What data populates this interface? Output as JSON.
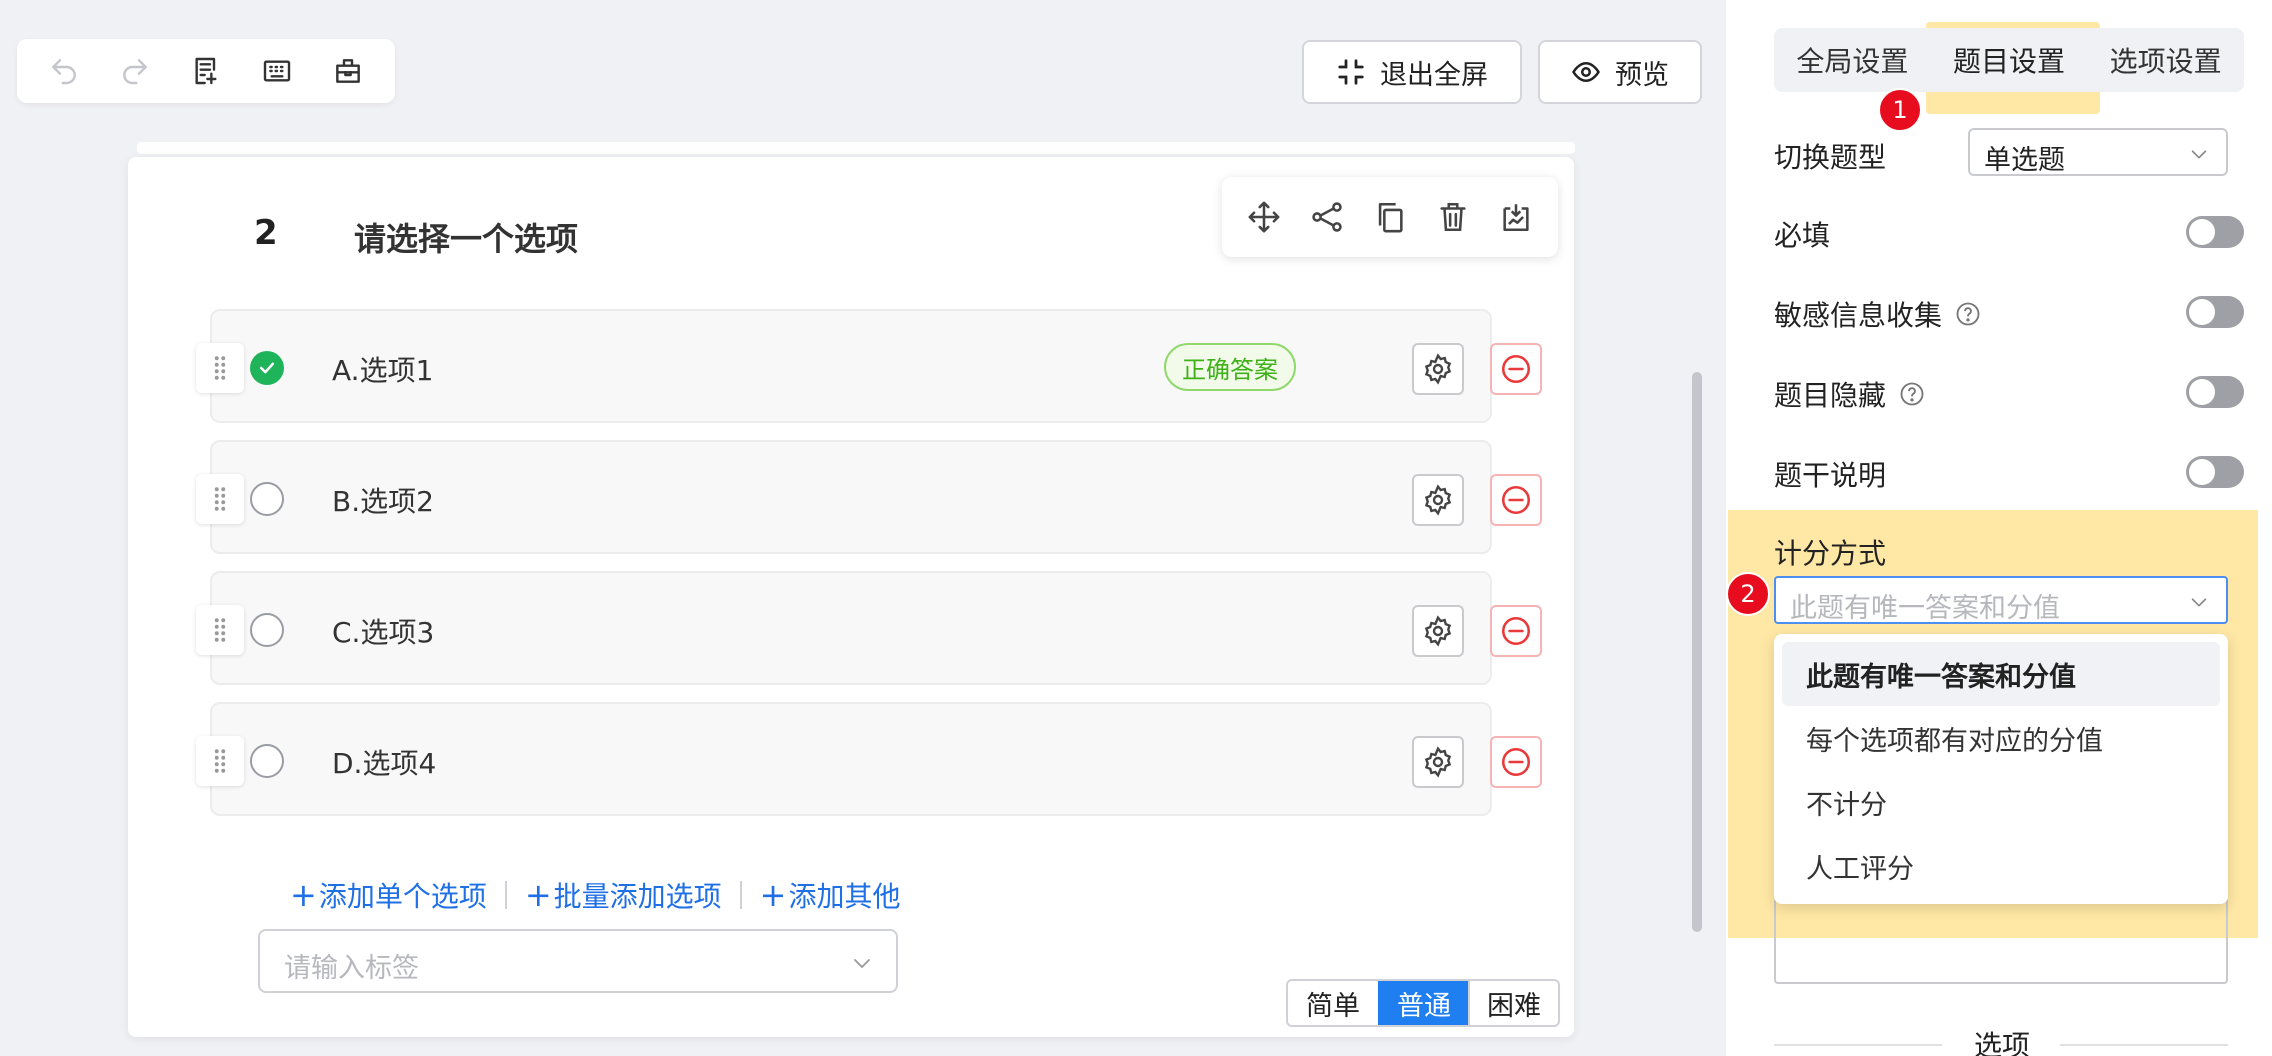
{
  "toolbar": {
    "undo_icon": "undo-icon",
    "redo_icon": "redo-icon",
    "note_icon": "edit-note-icon",
    "keyboard_icon": "keyboard-icon",
    "box_icon": "toolbox-icon"
  },
  "header": {
    "exit_fullscreen_label": "退出全屏",
    "preview_label": "预览"
  },
  "question": {
    "number": "2",
    "title": "请选择一个选项",
    "options": [
      {
        "label": "A.选项1",
        "checked": true,
        "tag": "正确答案"
      },
      {
        "label": "B.选项2",
        "checked": false
      },
      {
        "label": "C.选项3",
        "checked": false
      },
      {
        "label": "D.选项4",
        "checked": false
      }
    ],
    "add_single_option": "添加单个选项",
    "add_batch_options": "批量添加选项",
    "add_other": "添加其他",
    "tag_placeholder": "请输入标签",
    "difficulty": [
      "简单",
      "普通",
      "困难"
    ],
    "difficulty_selected": "普通"
  },
  "panel": {
    "tabs": [
      "全局设置",
      "题目设置",
      "选项设置"
    ],
    "active_tab": "题目设置",
    "badge_1": "1",
    "badge_2": "2",
    "switch_type_label": "切换题型",
    "switch_type_value": "单选题",
    "required_label": "必填",
    "sensitive_label": "敏感信息收集",
    "hidden_label": "题目隐藏",
    "stem_desc_label": "题干说明",
    "score_label": "计分方式",
    "score_placeholder": "此题有唯一答案和分值",
    "score_options": [
      "此题有唯一答案和分值",
      "每个选项都有对应的分值",
      "不计分",
      "人工评分"
    ],
    "options_section_label": "选项"
  },
  "colors": {
    "accent": "#1f7ef0",
    "link": "#1f6fe5",
    "correct": "#1fb45a",
    "danger": "#e9393a",
    "highlight": "#ffde82",
    "badge": "#e80d1e"
  }
}
